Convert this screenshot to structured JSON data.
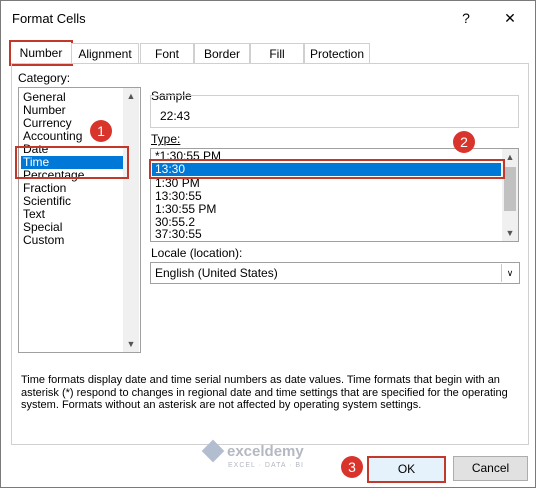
{
  "window": {
    "title": "Format Cells",
    "help_glyph": "?",
    "close_glyph": "✕"
  },
  "tabs": [
    "Number",
    "Alignment",
    "Font",
    "Border",
    "Fill",
    "Protection"
  ],
  "category": {
    "label": "Category:",
    "items": [
      "General",
      "Number",
      "Currency",
      "Accounting",
      "Date",
      "Time",
      "Percentage",
      "Fraction",
      "Scientific",
      "Text",
      "Special",
      "Custom"
    ],
    "selected": "Time"
  },
  "sample": {
    "label": "Sample",
    "value": "22:43"
  },
  "type": {
    "label": "Type:",
    "items": [
      "*1:30:55 PM",
      "13:30",
      "1:30 PM",
      "13:30:55",
      "1:30:55 PM",
      "30:55.2",
      "37:30:55"
    ],
    "selected": "13:30"
  },
  "locale": {
    "label": "Locale (location):",
    "value": "English (United States)"
  },
  "description": "Time formats display date and time serial numbers as date values.  Time formats that begin with an asterisk (*) respond to changes in regional date and time settings that are specified for the operating system. Formats without an asterisk are not affected by operating system settings.",
  "buttons": {
    "ok": "OK",
    "cancel": "Cancel"
  },
  "annotations": [
    "1",
    "2",
    "3"
  ],
  "watermark": {
    "name": "exceldemy",
    "tagline": "EXCEL · DATA · BI"
  },
  "colors": {
    "selection": "#0078d7",
    "highlight": "#c0392b",
    "badge": "#d9342b"
  },
  "icons": {
    "scroll_up": "▲",
    "scroll_down": "▼",
    "dropdown": "∨"
  }
}
